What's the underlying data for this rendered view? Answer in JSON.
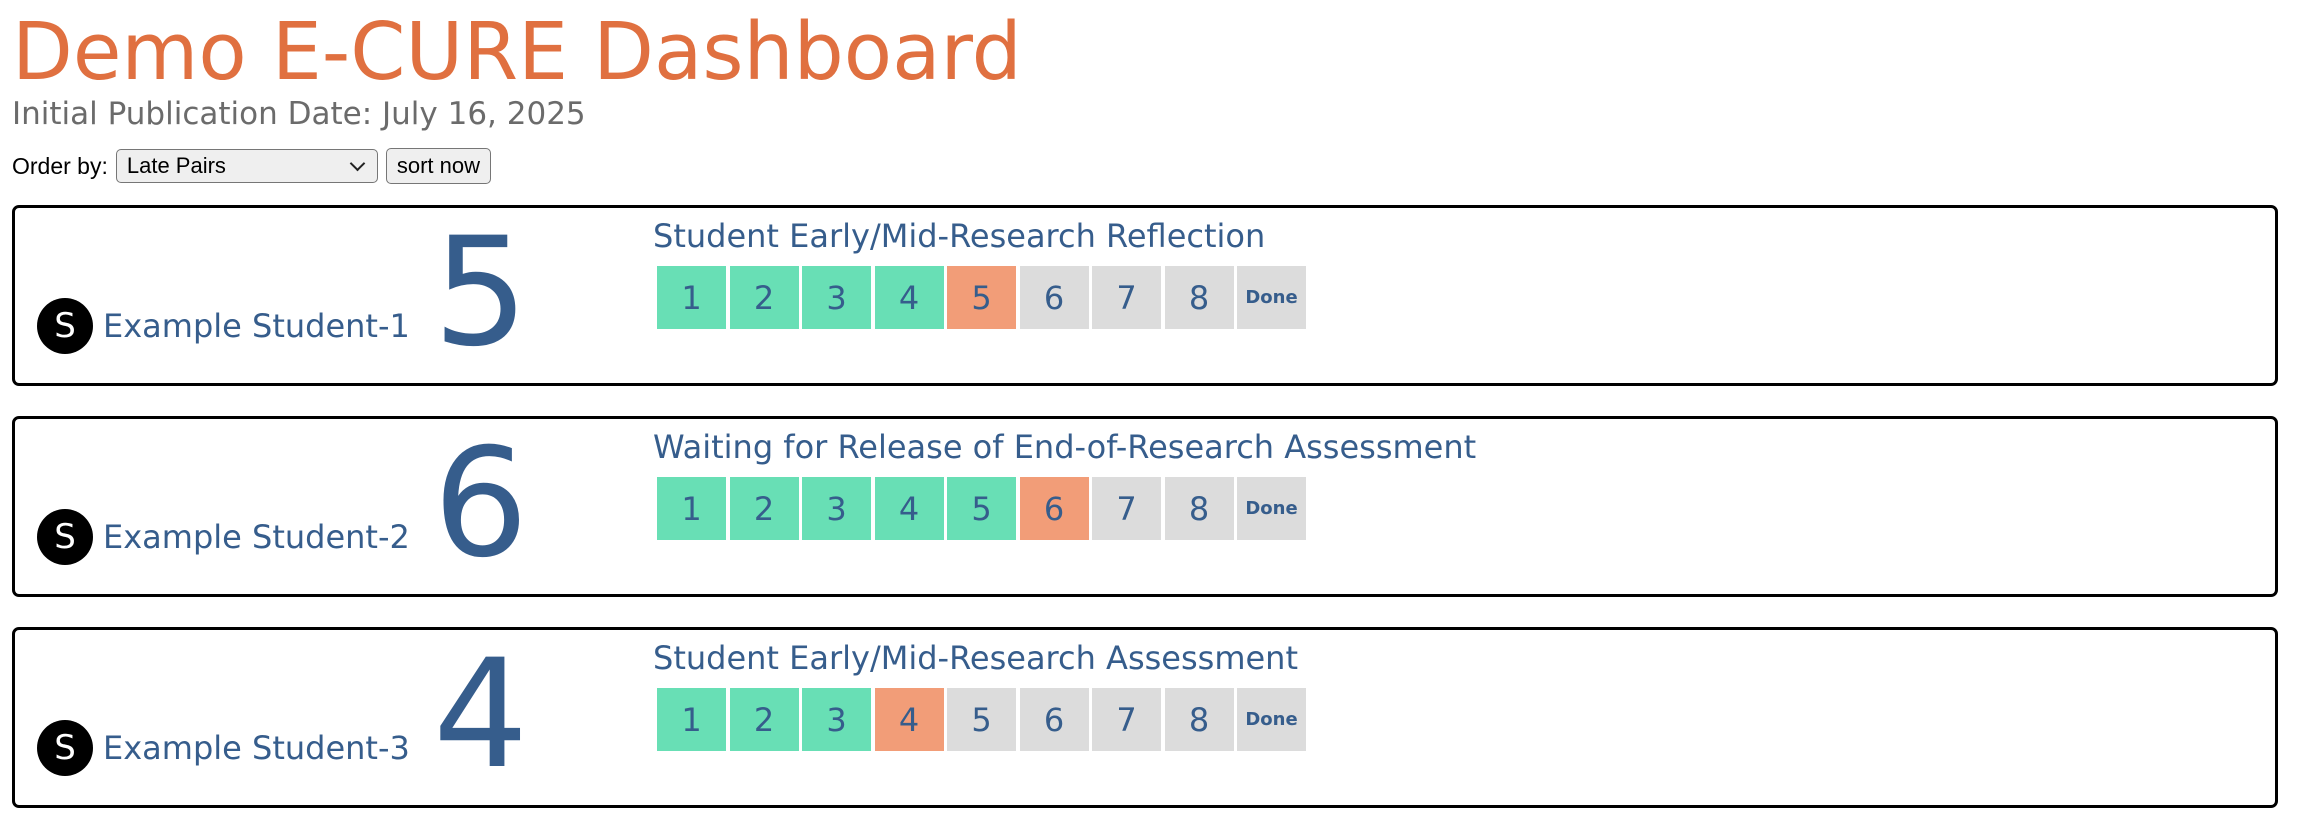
{
  "page": {
    "title": "Demo E-CURE Dashboard",
    "publication_date": "Initial Publication Date: July 16, 2025"
  },
  "order": {
    "label": "Order by:",
    "selected": "Late Pairs",
    "sort_button": "sort now"
  },
  "colors": {
    "title": "#e07040",
    "text": "#365d8c",
    "step_complete": "#68dfb5",
    "step_current": "#f29d78",
    "step_pending": "#dcdcdc"
  },
  "students": [
    {
      "initial": "S",
      "name": "Example Student-1",
      "stage_number": "5",
      "stage_title": "Student Early/Mid-Research Reflection",
      "steps": [
        {
          "label": "1",
          "status": "complete"
        },
        {
          "label": "2",
          "status": "complete"
        },
        {
          "label": "3",
          "status": "complete"
        },
        {
          "label": "4",
          "status": "complete"
        },
        {
          "label": "5",
          "status": "current"
        },
        {
          "label": "6",
          "status": "pending"
        },
        {
          "label": "7",
          "status": "pending"
        },
        {
          "label": "8",
          "status": "pending"
        },
        {
          "label": "Done",
          "status": "pending"
        }
      ]
    },
    {
      "initial": "S",
      "name": "Example Student-2",
      "stage_number": "6",
      "stage_title": "Waiting for Release of End-of-Research Assessment",
      "steps": [
        {
          "label": "1",
          "status": "complete"
        },
        {
          "label": "2",
          "status": "complete"
        },
        {
          "label": "3",
          "status": "complete"
        },
        {
          "label": "4",
          "status": "complete"
        },
        {
          "label": "5",
          "status": "complete"
        },
        {
          "label": "6",
          "status": "current"
        },
        {
          "label": "7",
          "status": "pending"
        },
        {
          "label": "8",
          "status": "pending"
        },
        {
          "label": "Done",
          "status": "pending"
        }
      ]
    },
    {
      "initial": "S",
      "name": "Example Student-3",
      "stage_number": "4",
      "stage_title": "Student Early/Mid-Research Assessment",
      "steps": [
        {
          "label": "1",
          "status": "complete"
        },
        {
          "label": "2",
          "status": "complete"
        },
        {
          "label": "3",
          "status": "complete"
        },
        {
          "label": "4",
          "status": "current"
        },
        {
          "label": "5",
          "status": "pending"
        },
        {
          "label": "6",
          "status": "pending"
        },
        {
          "label": "7",
          "status": "pending"
        },
        {
          "label": "8",
          "status": "pending"
        },
        {
          "label": "Done",
          "status": "pending"
        }
      ]
    }
  ]
}
